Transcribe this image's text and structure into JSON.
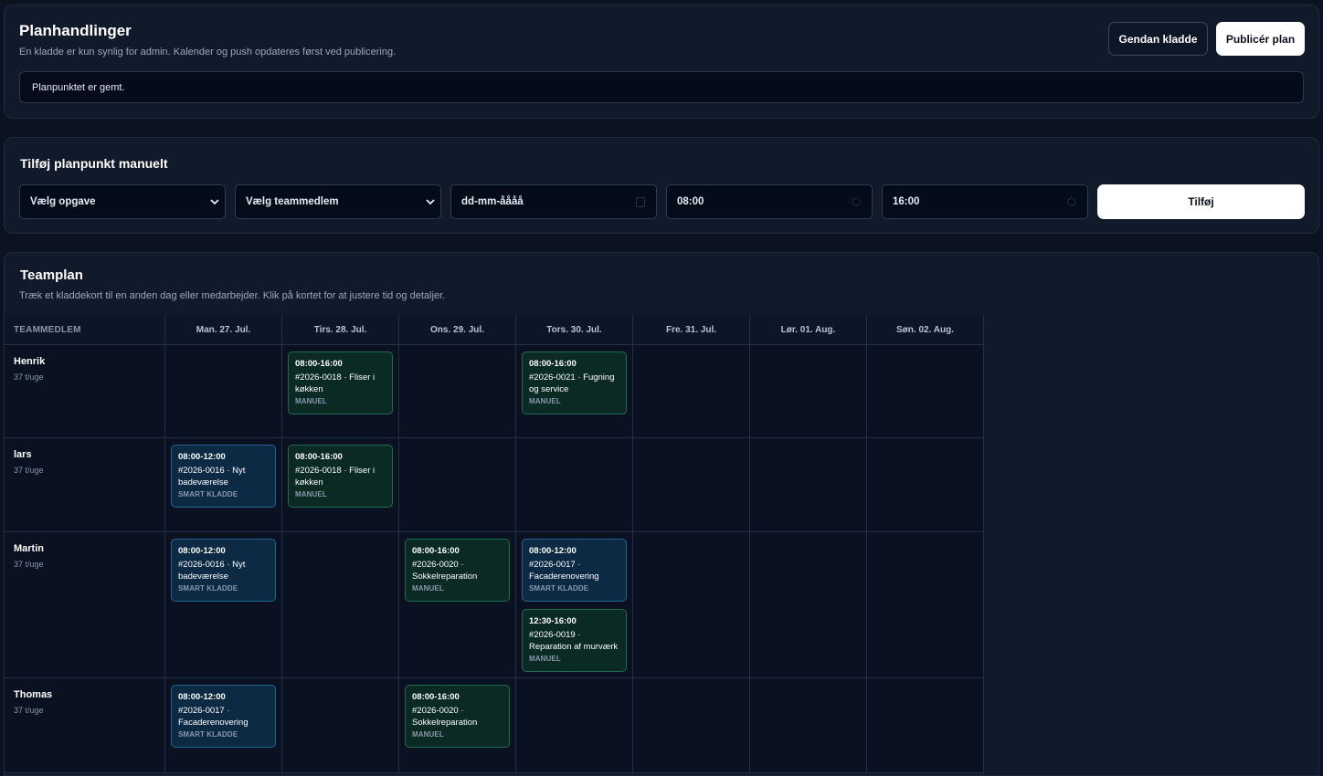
{
  "actions": {
    "title": "Planhandlinger",
    "subtitle": "En kladde er kun synlig for admin. Kalender og push opdateres først ved publicering.",
    "restore_label": "Gendan kladde",
    "publish_label": "Publicér plan",
    "status_message": "Planpunktet er gemt."
  },
  "add_form": {
    "title": "Tilføj planpunkt manuelt",
    "task_select": "Vælg opgave",
    "member_select": "Vælg teammedlem",
    "date_value": "dd-mm-åååå",
    "start_time": "08:00",
    "end_time": "16:00",
    "add_label": "Tilføj"
  },
  "teamplan": {
    "title": "Teamplan",
    "subtitle": "Træk et kladdekort til en anden dag eller medarbejder. Klik på kortet for at justere tid og detaljer.",
    "member_header": "TEAMMEDLEM",
    "days": [
      "Man. 27. Jul.",
      "Tirs. 28. Jul.",
      "Ons. 29. Jul.",
      "Tors. 30. Jul.",
      "Fre. 31. Jul.",
      "Lør. 01. Aug.",
      "Søn. 02. Aug."
    ],
    "members": [
      {
        "name": "Henrik",
        "hours": "37 t/uge"
      },
      {
        "name": "lars",
        "hours": "37 t/uge"
      },
      {
        "name": "Martin",
        "hours": "37 t/uge"
      },
      {
        "name": "Thomas",
        "hours": "37 t/uge"
      }
    ],
    "cards": [
      {
        "member": 0,
        "day": 1,
        "slot": 0,
        "kind": "manuel",
        "time": "08:00-16:00",
        "desc": "#2026-0018 · Fliser i køkken",
        "tag": "MANUEL"
      },
      {
        "member": 0,
        "day": 3,
        "slot": 0,
        "kind": "manuel",
        "time": "08:00-16:00",
        "desc": "#2026-0021 · Fugning og service",
        "tag": "MANUEL"
      },
      {
        "member": 1,
        "day": 0,
        "slot": 0,
        "kind": "smart",
        "time": "08:00-12:00",
        "desc": "#2026-0016 · Nyt badeværelse",
        "tag": "SMART KLADDE"
      },
      {
        "member": 1,
        "day": 1,
        "slot": 0,
        "kind": "manuel",
        "time": "08:00-16:00",
        "desc": "#2026-0018 · Fliser i køkken",
        "tag": "MANUEL"
      },
      {
        "member": 2,
        "day": 0,
        "slot": 0,
        "kind": "smart",
        "time": "08:00-12:00",
        "desc": "#2026-0016 · Nyt badeværelse",
        "tag": "SMART KLADDE"
      },
      {
        "member": 2,
        "day": 2,
        "slot": 0,
        "kind": "manuel",
        "time": "08:00-16:00",
        "desc": "#2026-0020 · Sokkelreparation",
        "tag": "MANUEL"
      },
      {
        "member": 2,
        "day": 3,
        "slot": 0,
        "kind": "smart",
        "time": "08:00-12:00",
        "desc": "#2026-0017 · Facaderenovering",
        "tag": "SMART KLADDE"
      },
      {
        "member": 2,
        "day": 3,
        "slot": 1,
        "kind": "manuel",
        "time": "12:30-16:00",
        "desc": "#2026-0019 · Reparation af murværk",
        "tag": "MANUEL"
      },
      {
        "member": 3,
        "day": 0,
        "slot": 0,
        "kind": "smart",
        "time": "08:00-12:00",
        "desc": "#2026-0017 · Facaderenovering",
        "tag": "SMART KLADDE"
      },
      {
        "member": 3,
        "day": 2,
        "slot": 0,
        "kind": "manuel",
        "time": "08:00-16:00",
        "desc": "#2026-0020 · Sokkelreparation",
        "tag": "MANUEL"
      }
    ]
  },
  "colors": {
    "background": "#0b1220",
    "panel": "#111a2a",
    "manual_card": "#0a2a23",
    "smart_card": "#0c2a44"
  }
}
